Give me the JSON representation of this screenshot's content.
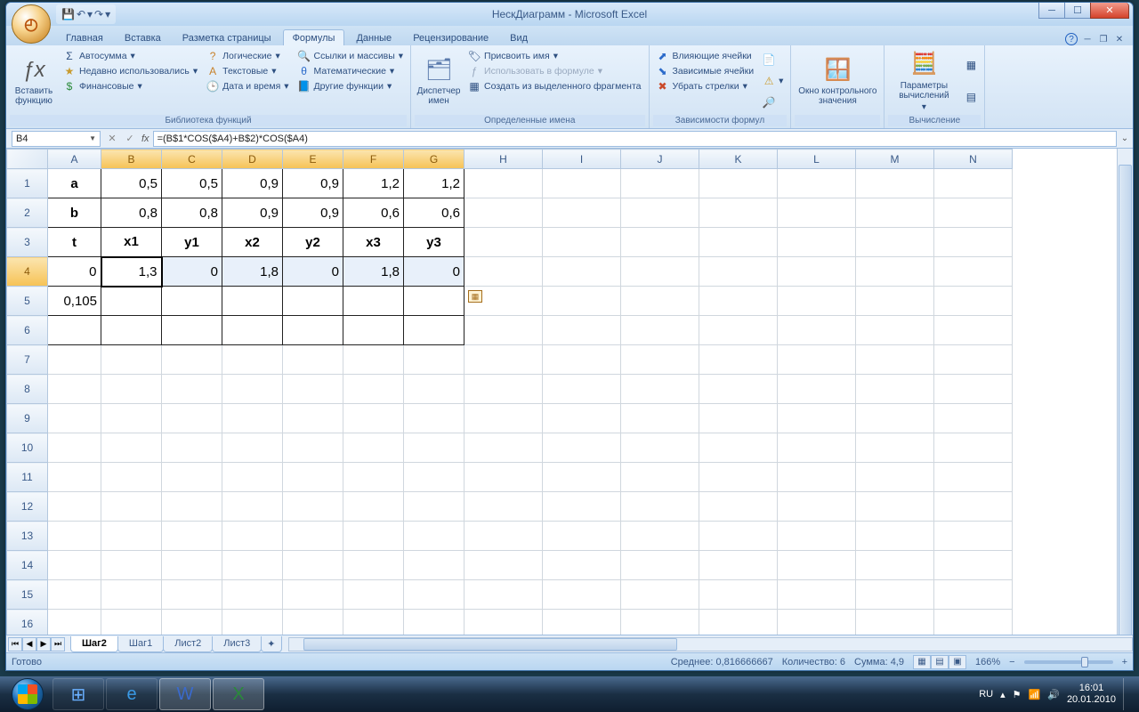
{
  "window": {
    "title": "НескДиаграмм - Microsoft Excel"
  },
  "qat": {
    "save": "💾",
    "undo": "↶",
    "redo": "↷",
    "dd": "▾"
  },
  "tabs": {
    "home": "Главная",
    "insert": "Вставка",
    "layout": "Разметка страницы",
    "formulas": "Формулы",
    "data": "Данные",
    "review": "Рецензирование",
    "view": "Вид"
  },
  "ribbon": {
    "insert_fn": "Вставить функцию",
    "fx": "ƒx",
    "lib": {
      "autosum": "Автосумма",
      "recent": "Недавно использовались",
      "financial": "Финансовые",
      "logical": "Логические",
      "text": "Текстовые",
      "datetime": "Дата и время",
      "lookup": "Ссылки и массивы",
      "math": "Математические",
      "more": "Другие функции",
      "label": "Библиотека функций"
    },
    "names": {
      "mgr": "Диспетчер имен",
      "define": "Присвоить имя",
      "use": "Использовать в формуле",
      "create": "Создать из выделенного фрагмента",
      "label": "Определенные имена"
    },
    "audit": {
      "prec": "Влияющие ячейки",
      "dep": "Зависимые ячейки",
      "remove": "Убрать стрелки",
      "label": "Зависимости формул"
    },
    "watch": "Окно контрольного значения",
    "calc": {
      "opts": "Параметры вычислений",
      "label": "Вычисление"
    }
  },
  "namebox": "B4",
  "formula": "=(B$1*COS($A4)+B$2)*COS($A4)",
  "cols": [
    "A",
    "B",
    "C",
    "D",
    "E",
    "F",
    "G",
    "H",
    "I",
    "J",
    "K",
    "L",
    "M",
    "N"
  ],
  "grid": {
    "r1": {
      "A": "a",
      "B": "0,5",
      "C": "0,5",
      "D": "0,9",
      "E": "0,9",
      "F": "1,2",
      "G": "1,2"
    },
    "r2": {
      "A": "b",
      "B": "0,8",
      "C": "0,8",
      "D": "0,9",
      "E": "0,9",
      "F": "0,6",
      "G": "0,6"
    },
    "r3": {
      "A": "t",
      "B": "x1",
      "C": "y1",
      "D": "x2",
      "E": "y2",
      "F": "x3",
      "G": "y3"
    },
    "r4": {
      "A": "0",
      "B": "1,3",
      "C": "0",
      "D": "1,8",
      "E": "0",
      "F": "1,8",
      "G": "0"
    },
    "r5": {
      "A": "0,105"
    }
  },
  "sheets": {
    "s1": "Шаг2",
    "s2": "Шаг1",
    "s3": "Лист2",
    "s4": "Лист3"
  },
  "status": {
    "ready": "Готово",
    "avg": "Среднее: 0,816666667",
    "count": "Количество: 6",
    "sum": "Сумма: 4,9",
    "zoom": "166%"
  },
  "tray": {
    "lang": "RU",
    "time": "16:01",
    "date": "20.01.2010"
  }
}
